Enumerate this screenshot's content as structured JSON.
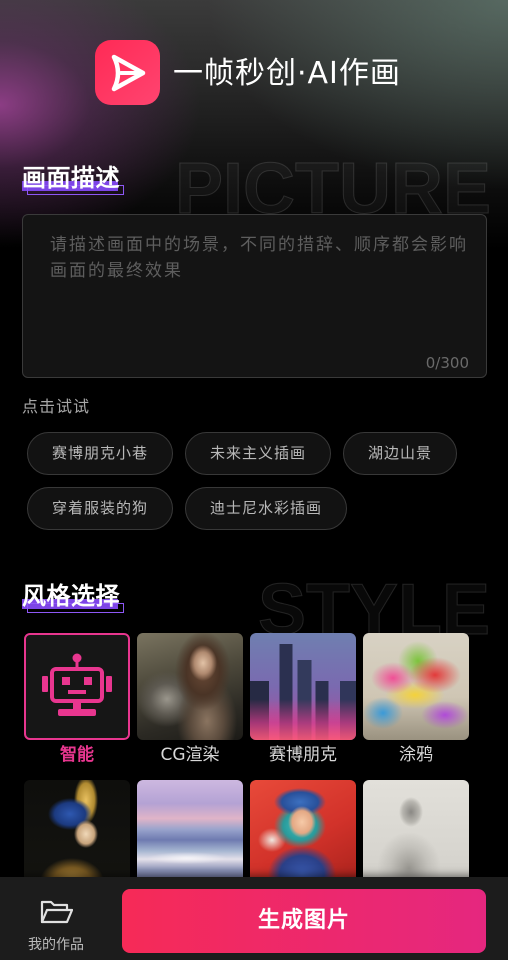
{
  "app": {
    "title": "一帧秒创·AI作画",
    "logo_icon": "app-logo-icon"
  },
  "description_section": {
    "heading": "画面描述",
    "bg_word": "PICTURE",
    "placeholder": "请描述画面中的场景，不同的措辞、顺序都会影响画面的最终效果",
    "value": "",
    "counter": "0/300"
  },
  "suggestions": {
    "label": "点击试试",
    "items": [
      "赛博朋克小巷",
      "未来主义插画",
      "湖边山景",
      "穿着服装的狗",
      "迪士尼水彩插画"
    ]
  },
  "style_section": {
    "heading": "风格选择",
    "bg_word": "STYLE",
    "selected_index": 0,
    "styles": [
      {
        "label": "智能",
        "icon": "robot-icon"
      },
      {
        "label": "CG渲染"
      },
      {
        "label": "赛博朋克"
      },
      {
        "label": "涂鸦"
      }
    ]
  },
  "bottom_bar": {
    "my_works_icon": "folder-icon",
    "my_works_label": "我的作品",
    "generate_label": "生成图片"
  },
  "colors": {
    "accent": "#e8368f",
    "heading_highlight": "#7d45e6",
    "button_gradient_start": "#f62a57",
    "button_gradient_end": "#e5277f",
    "logo_gradient_start": "#ff2a55",
    "logo_gradient_end": "#ff4470"
  }
}
